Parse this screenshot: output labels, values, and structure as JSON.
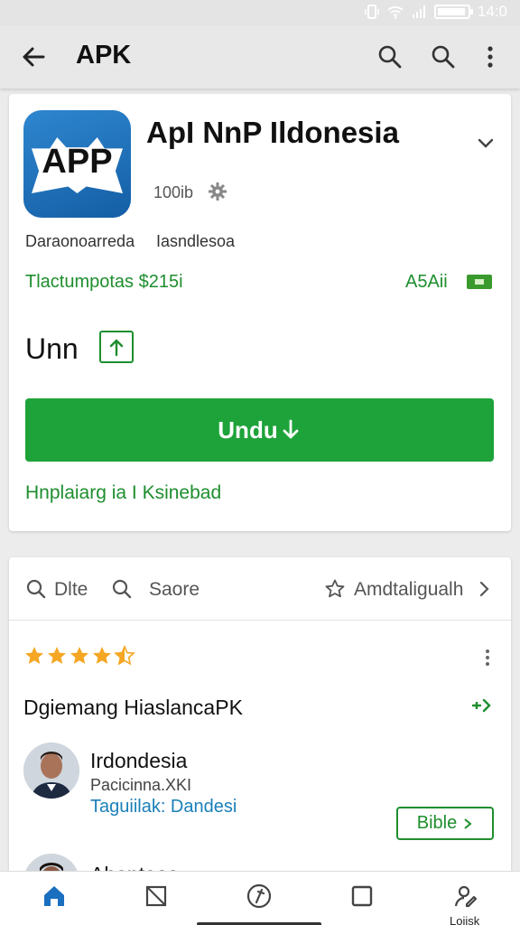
{
  "status": {
    "time": "14:0"
  },
  "appbar": {
    "title": "APK"
  },
  "app": {
    "icon_text": "APP",
    "title": "ApI NnP Ildonesia",
    "size": "100ib",
    "developer_left": "Daraonoarreda",
    "developer_right": "Iasndlesoa",
    "green_left": "Tlactumpotas $215i",
    "green_right": "A5Aii",
    "unn_label": "Unn",
    "primary_button": "Undu",
    "link_text": "Hnplaiarg ia I Ksinebad"
  },
  "tabs": [
    {
      "label": "Dlte",
      "icon": "search-icon"
    },
    {
      "label": "Saore",
      "icon": "search-icon"
    },
    {
      "label": "Amdtaligualh",
      "icon": "star-outline-icon"
    }
  ],
  "rating": {
    "stars": 4.5
  },
  "section_title": "Dgiemang HiaslancaPK",
  "review": {
    "name": "Irdondesia",
    "subtitle": "Pacicinna.XKI",
    "link": "Taguiilak: Dandesi",
    "button": "Bible"
  },
  "review2": {
    "name": "Abantaes"
  },
  "bottom_nav": {
    "items": [
      "home-icon",
      "crop-icon",
      "compass-icon",
      "square-icon",
      "person-edit-icon"
    ],
    "last_label": "Lojisk"
  },
  "colors": {
    "accent_green": "#1ea33a",
    "link_blue": "#1a7fb8",
    "icon_blue": "#1a6fbf"
  }
}
